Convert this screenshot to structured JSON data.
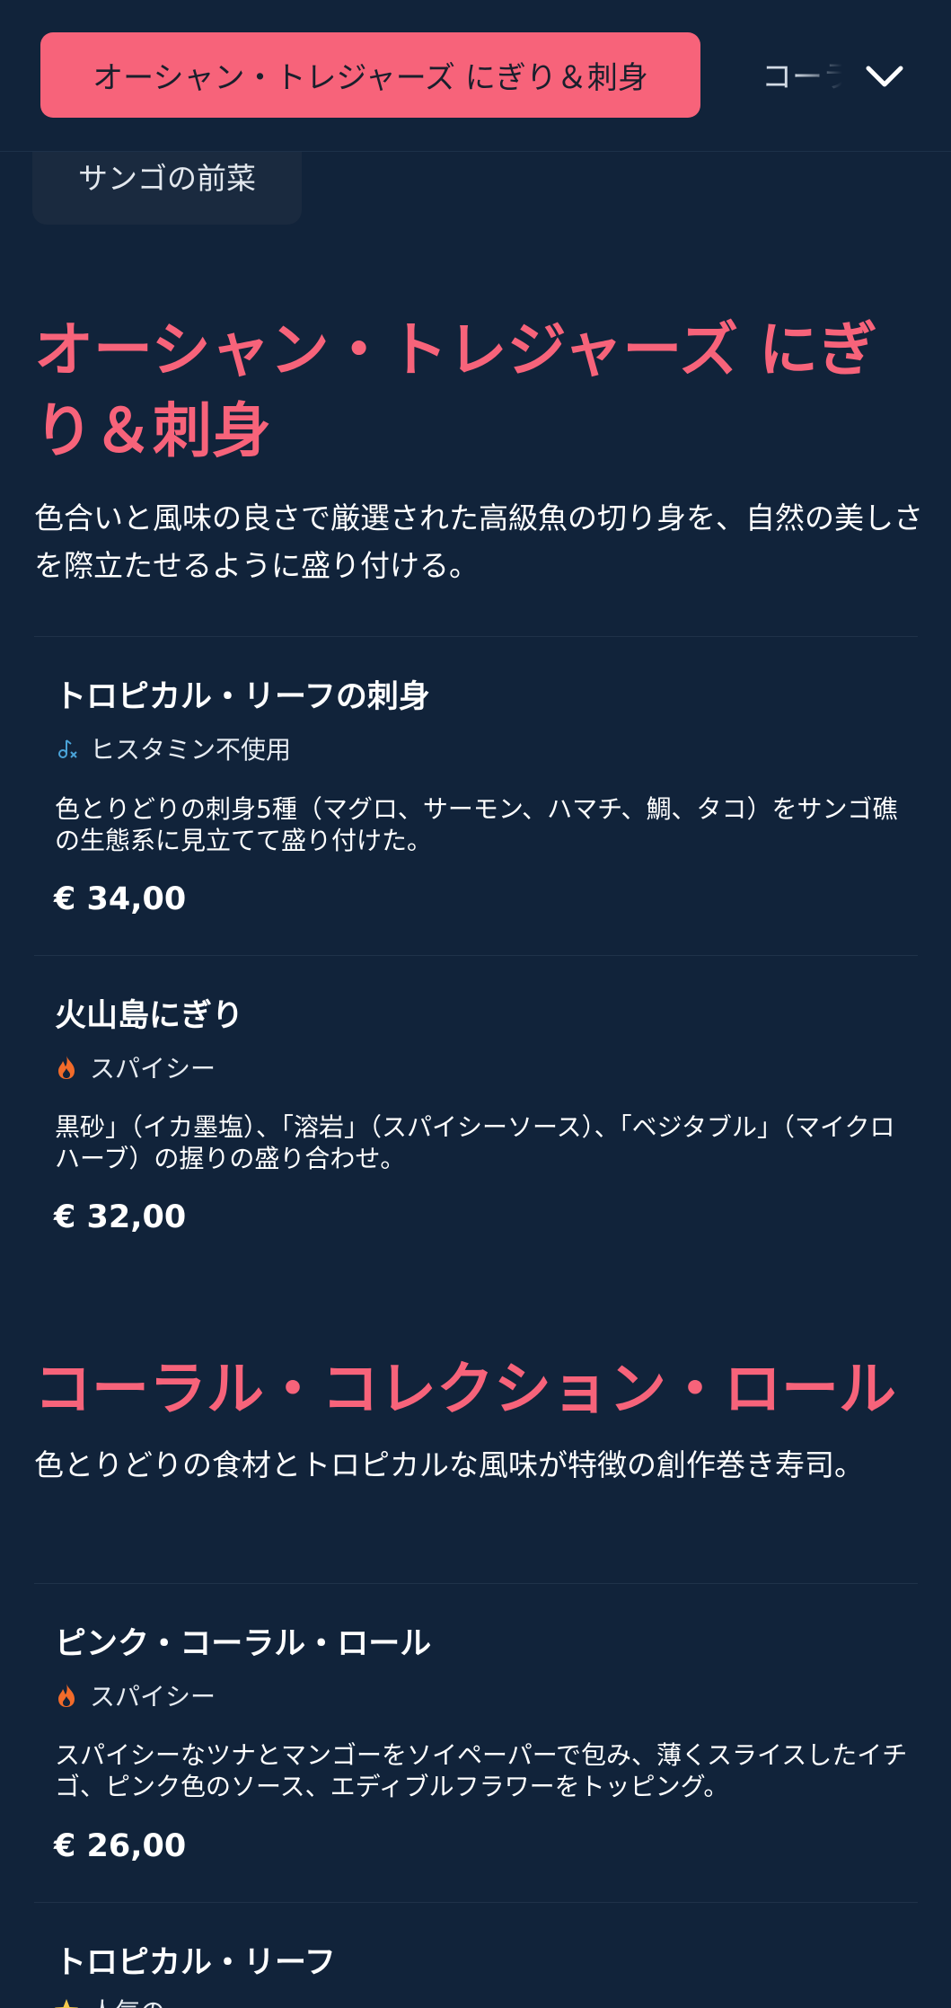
{
  "nav": {
    "active_tab": "オーシャン・トレジャーズ にぎり＆刺身",
    "next_tab": "コーラル・コレクション・ロール",
    "chip": "サンゴの前菜"
  },
  "sections": [
    {
      "title": "オーシャン・トレジャーズ にぎり＆刺身",
      "description": "色合いと風味の良さで厳選された高級魚の切り身を、自然の美しさを際立たせるように盛り付ける。",
      "items": [
        {
          "name": "トロピカル・リーフの刺身",
          "tag": "ヒスタミン不使用",
          "tag_icon": "histamine-free-icon",
          "description": "色とりどりの刺身5種（マグロ、サーモン、ハマチ、鯛、タコ）をサンゴ礁の生態系に見立てて盛り付けた。",
          "price": "€ 34,00"
        },
        {
          "name": "火山島にぎり",
          "tag": "スパイシー",
          "tag_icon": "flame-icon",
          "description": "黒砂」（イカ墨塩）、「溶岩」（スパイシーソース）、「ベジタブル」（マイクロハーブ）の握りの盛り合わせ。",
          "price": "€ 32,00"
        }
      ]
    },
    {
      "title": "コーラル・コレクション・ロール",
      "description": "色とりどりの食材とトロピカルな風味が特徴の創作巻き寿司。",
      "items": [
        {
          "name": "ピンク・コーラル・ロール",
          "tag": "スパイシー",
          "tag_icon": "flame-icon",
          "description": "スパイシーなツナとマンゴーをソイペーパーで包み、薄くスライスしたイチゴ、ピンク色のソース、エディブルフラワーをトッピング。",
          "price": "€ 26,00"
        },
        {
          "name": "トロピカル・リーフ",
          "tag": "人気の",
          "tag_icon": "star-icon"
        }
      ]
    }
  ],
  "colors": {
    "background": "#11233a",
    "accent": "#f7637a",
    "flame": "#f26b2a",
    "histamine_icon": "#4aa3d8",
    "star": "#f5c84b"
  }
}
